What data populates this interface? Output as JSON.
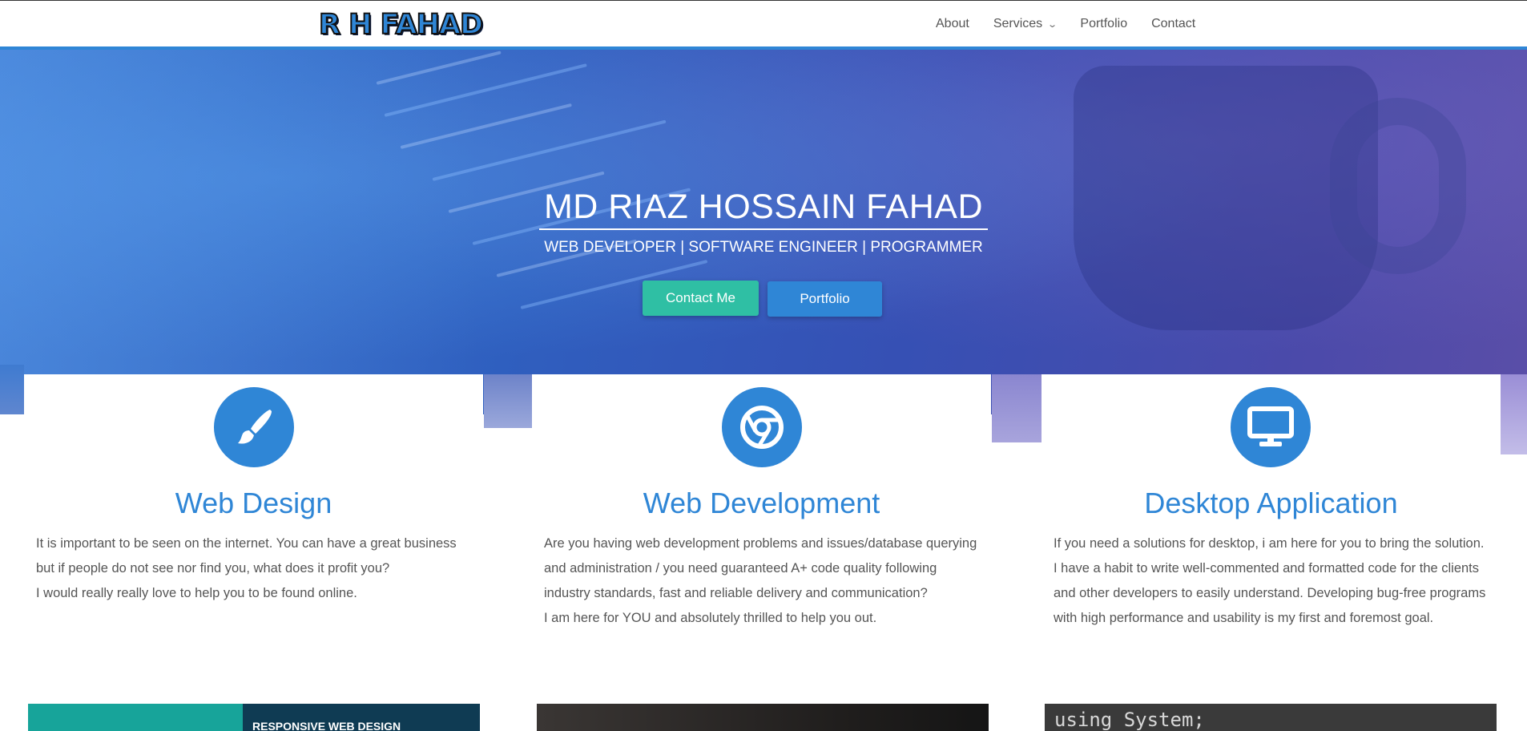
{
  "header": {
    "logo_text": "R H FAHAD",
    "nav": [
      {
        "label": "About"
      },
      {
        "label": "Services",
        "has_dropdown": true
      },
      {
        "label": "Portfolio"
      },
      {
        "label": "Contact"
      }
    ]
  },
  "hero": {
    "title": "MD RIAZ HOSSAIN FAHAD",
    "subtitle": "WEB DEVELOPER | SOFTWARE ENGINEER | PROGRAMMER",
    "contact_button": "Contact Me",
    "portfolio_button": "Portfolio"
  },
  "services": [
    {
      "icon": "paintbrush-icon",
      "title": "Web Design",
      "paragraphs": [
        "It is important to be seen on the internet. You can have a great business but if people do not see nor find you, what does it profit you?",
        "I would really really love to help you to be found online."
      ]
    },
    {
      "icon": "chrome-icon",
      "title": "Web Development",
      "paragraphs": [
        "Are you having web development problems and issues/database querying and administration / you need guaranteed A+ code quality following industry standards, fast and reliable delivery and communication?",
        "I am here for YOU and absolutely thrilled to help you out."
      ]
    },
    {
      "icon": "desktop-icon",
      "title": "Desktop Application",
      "paragraphs": [
        "If you need a solutions for desktop, i am here for you to bring the solution.",
        "I have a habit to write well-commented and formatted code for the clients and other developers to easily understand. Developing bug-free programs with high performance and usability is my first and foremost goal."
      ]
    }
  ],
  "portfolio_thumbs": {
    "thumb1_text": "RESPONSIVE WEB DESIGN",
    "thumb3_text": "using System;"
  },
  "colors": {
    "accent": "#2f86d6",
    "teal": "#2fbfa4"
  }
}
